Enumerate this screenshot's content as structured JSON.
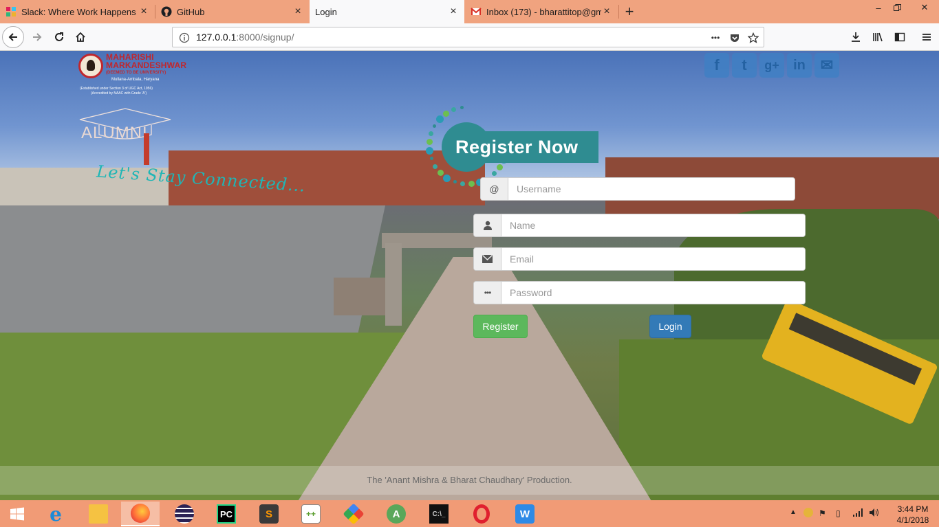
{
  "browser": {
    "tabs": [
      {
        "title": "Slack: Where Work Happens",
        "icon": "slack-icon",
        "active": false
      },
      {
        "title": "GitHub",
        "icon": "github-icon",
        "active": false
      },
      {
        "title": "Login",
        "icon": "",
        "active": true
      },
      {
        "title": "Inbox (173) - bharattitop@gma",
        "icon": "gmail-icon",
        "active": false
      }
    ],
    "url_host": "127.0.0.1",
    "url_rest": ":8000/signup/",
    "page_actions_icon": "•••"
  },
  "page": {
    "university": {
      "name_line1": "MAHARISHI",
      "name_line2": "MARKANDESHWAR",
      "deemed": "(DEEMED TO BE UNIVERSITY)",
      "location": "Mullana-Ambala, Haryana",
      "established": "(Established under Section 3 of UGC Act, 1956)",
      "naac": "(Accredited by NAAC with Grade 'A')"
    },
    "alumni_label": "ALUMNI",
    "tagline": "Let's Stay Connected...",
    "social": [
      {
        "icon": "facebook-icon",
        "glyph": "f"
      },
      {
        "icon": "twitter-icon",
        "glyph": "t"
      },
      {
        "icon": "google-plus-icon",
        "glyph": "g+"
      },
      {
        "icon": "linkedin-icon",
        "glyph": "in"
      },
      {
        "icon": "mail-icon",
        "glyph": "✉"
      }
    ],
    "heading": "Register Now",
    "form": {
      "username": {
        "addon": "@",
        "placeholder": "Username",
        "value": ""
      },
      "name": {
        "addon_icon": "user-icon",
        "placeholder": "Name",
        "value": ""
      },
      "email": {
        "addon_icon": "envelope-icon",
        "placeholder": "Email",
        "value": ""
      },
      "password": {
        "addon": "•••",
        "placeholder": "Password",
        "value": ""
      },
      "register_label": "Register",
      "login_label": "Login"
    },
    "footer": "The 'Anant Mishra & Bharat Chaudhary' Production."
  },
  "taskbar": {
    "time": "3:44 PM",
    "date": "4/1/2018"
  },
  "colors": {
    "tabbar": "#f0a37f",
    "taskbar": "#f19b76",
    "brand_teal": "#2f8c91",
    "register_green": "#5cb85c",
    "login_blue": "#337ab7"
  }
}
